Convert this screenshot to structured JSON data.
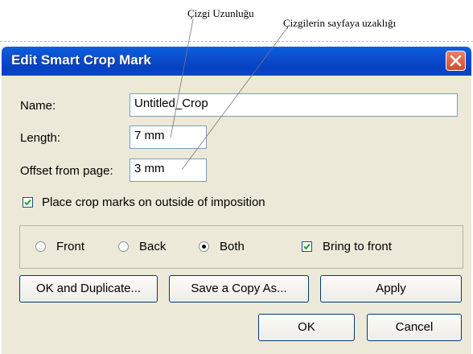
{
  "annotations": {
    "length_label": "Çizgi Uzunluğu",
    "offset_label": "Çizgilerin sayfaya uzaklığı"
  },
  "dialog": {
    "title": "Edit Smart Crop Mark",
    "close_icon": "close-icon",
    "name_label": "Name:",
    "name_value": "Untitled_Crop",
    "length_label": "Length:",
    "length_value": "7 mm",
    "offset_label": "Offset from page:",
    "offset_value": "3 mm",
    "outside_label": "Place crop marks on outside of imposition",
    "outside_checked": true,
    "radios": [
      {
        "label": "Front",
        "selected": false
      },
      {
        "label": "Back",
        "selected": false
      },
      {
        "label": "Both",
        "selected": true
      }
    ],
    "bring_label": "Bring to front",
    "bring_checked": true,
    "buttons": {
      "ok_duplicate": "OK and Duplicate...",
      "save_copy": "Save a Copy As...",
      "apply": "Apply",
      "ok": "OK",
      "cancel": "Cancel"
    }
  }
}
